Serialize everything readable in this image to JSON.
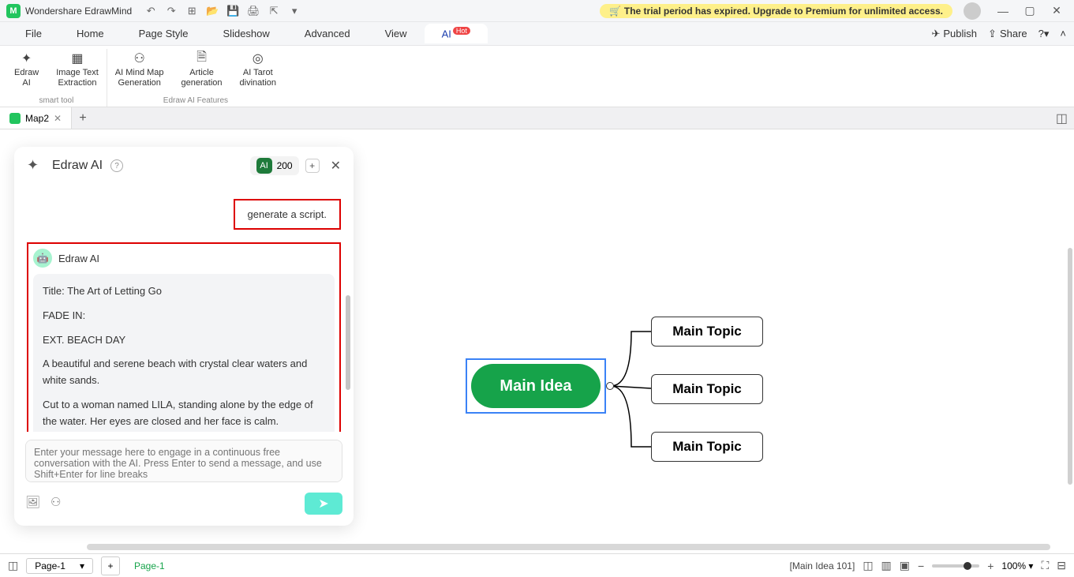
{
  "titlebar": {
    "appname": "Wondershare EdrawMind",
    "trial_text": "The trial period has expired. Upgrade to Premium for unlimited access."
  },
  "menubar": {
    "items": [
      "File",
      "Home",
      "Page Style",
      "Slideshow",
      "Advanced",
      "View",
      "AI"
    ],
    "hot_badge": "Hot",
    "publish": "Publish",
    "share": "Share"
  },
  "ribbon": {
    "group1_label": "smart tool",
    "group2_label": "Edraw AI Features",
    "btns": {
      "edraw_ai": "Edraw\nAI",
      "image_text": "Image Text\nExtraction",
      "mind_map": "AI Mind Map\nGeneration",
      "article": "Article\ngeneration",
      "tarot": "AI Tarot\ndivination"
    }
  },
  "doctab": {
    "name": "Map2"
  },
  "ai_panel": {
    "title": "Edraw AI",
    "tokens": "200",
    "user_message": "generate a script.",
    "bot_name": "Edraw AI",
    "response": {
      "title": "Title: The Art of Letting Go",
      "l1": "FADE IN:",
      "l2": "EXT. BEACH  DAY",
      "l3": "A beautiful and serene beach with crystal clear waters and white sands.",
      "l4": "Cut to a woman named LILA, standing alone by the edge of the water. Her eyes are closed and her face is calm."
    },
    "placeholder": "Enter your message here to engage in a continuous free conversation with the AI. Press Enter to send a message, and use Shift+Enter for line breaks"
  },
  "mindmap": {
    "main": "Main Idea",
    "topics": [
      "Main Topic",
      "Main Topic",
      "Main Topic"
    ]
  },
  "statusbar": {
    "page_sel": "Page-1",
    "page_name": "Page-1",
    "status": "[Main Idea 101]",
    "zoom": "100%"
  }
}
